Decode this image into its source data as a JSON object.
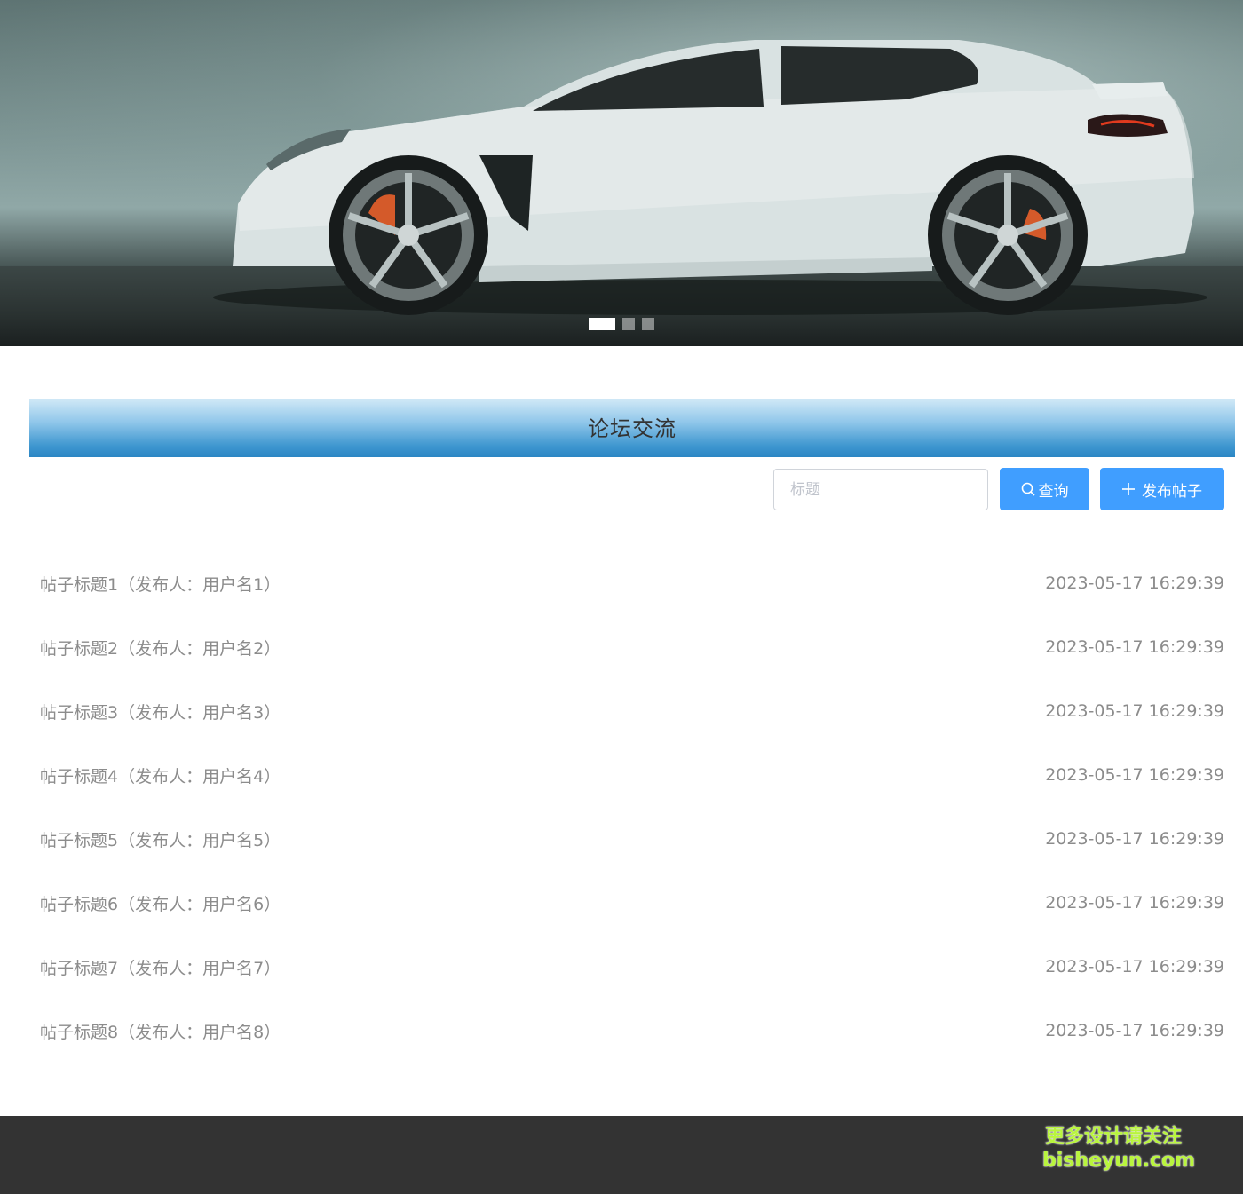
{
  "banner": {
    "slide_count": 3,
    "active_index": 0
  },
  "section": {
    "title": "论坛交流"
  },
  "search": {
    "placeholder": "标题",
    "value": "",
    "query_label": "查询",
    "post_label": "发布帖子",
    "accent_color": "#409eff"
  },
  "posts": [
    {
      "title": "帖子标题1（发布人：用户名1）",
      "time": "2023-05-17 16:29:39"
    },
    {
      "title": "帖子标题2（发布人：用户名2）",
      "time": "2023-05-17 16:29:39"
    },
    {
      "title": "帖子标题3（发布人：用户名3）",
      "time": "2023-05-17 16:29:39"
    },
    {
      "title": "帖子标题4（发布人：用户名4）",
      "time": "2023-05-17 16:29:39"
    },
    {
      "title": "帖子标题5（发布人：用户名5）",
      "time": "2023-05-17 16:29:39"
    },
    {
      "title": "帖子标题6（发布人：用户名6）",
      "time": "2023-05-17 16:29:39"
    },
    {
      "title": "帖子标题7（发布人：用户名7）",
      "time": "2023-05-17 16:29:39"
    },
    {
      "title": "帖子标题8（发布人：用户名8）",
      "time": "2023-05-17 16:29:39"
    }
  ],
  "footer": {
    "watermark_line1": "更多设计请关注",
    "watermark_line2": "bisheyun.com"
  }
}
